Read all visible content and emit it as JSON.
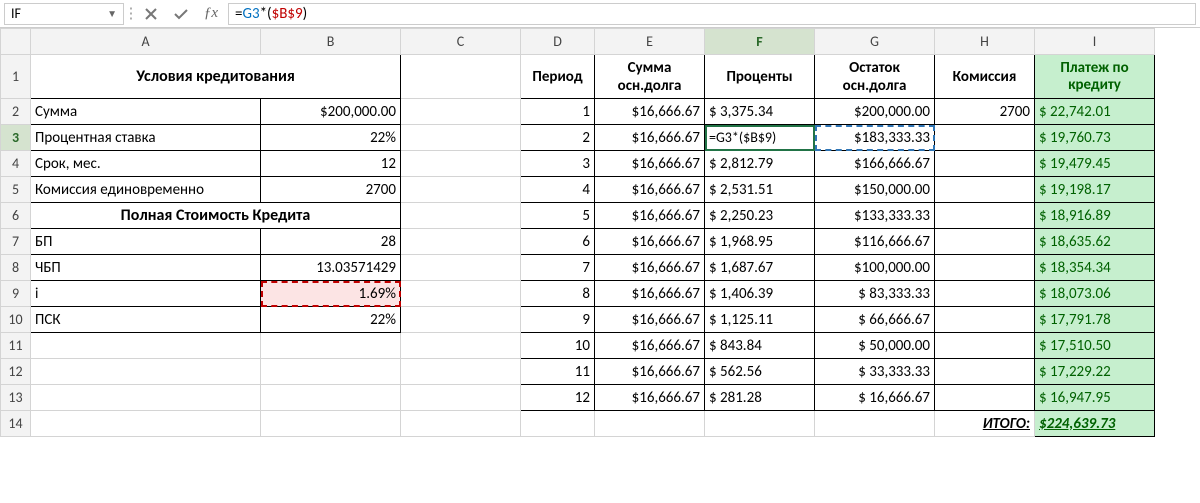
{
  "nameBox": "IF",
  "formula": {
    "prefix": "=",
    "ref1": "G3",
    "mid": "*(",
    "ref2": "$B$9",
    "suffix": ")"
  },
  "columns": [
    "A",
    "B",
    "C",
    "D",
    "E",
    "F",
    "G",
    "H",
    "I"
  ],
  "activeCol": "F",
  "activeRow": "3",
  "left": {
    "title": "Условия кредитования",
    "rows": [
      {
        "label": "Сумма",
        "value": "$200,000.00"
      },
      {
        "label": "Процентная ставка",
        "value": "22%"
      },
      {
        "label": "Срок, мес.",
        "value": "12"
      },
      {
        "label": "Комиссия единовременно",
        "value": "2700"
      }
    ],
    "title2": "Полная Стоимость Кредита",
    "rows2": [
      {
        "label": "БП",
        "value": "28"
      },
      {
        "label": "ЧБП",
        "value": "13.03571429"
      },
      {
        "label": "i",
        "value": "1.69%"
      },
      {
        "label": "ПСК",
        "value": "22%"
      }
    ]
  },
  "right": {
    "headers": {
      "D": "Период",
      "E_l1": "Сумма",
      "E_l2": "осн.долга",
      "F": "Проценты",
      "G_l1": "Остаток",
      "G_l2": "осн.долга",
      "H": "Комиссия",
      "I_l1": "Платеж по",
      "I_l2": "кредиту"
    },
    "rows": [
      {
        "p": "1",
        "sum": "$16,666.67",
        "pct": "$  3,375.34",
        "bal": "$200,000.00",
        "kom": "2700",
        "pay": "$  22,742.01"
      },
      {
        "p": "2",
        "sum": "$16,666.67",
        "pct": "=G3*($B$9)",
        "bal": "$183,333.33",
        "kom": "",
        "pay": "$  19,760.73"
      },
      {
        "p": "3",
        "sum": "$16,666.67",
        "pct": "$  2,812.79",
        "bal": "$166,666.67",
        "kom": "",
        "pay": "$  19,479.45"
      },
      {
        "p": "4",
        "sum": "$16,666.67",
        "pct": "$  2,531.51",
        "bal": "$150,000.00",
        "kom": "",
        "pay": "$  19,198.17"
      },
      {
        "p": "5",
        "sum": "$16,666.67",
        "pct": "$  2,250.23",
        "bal": "$133,333.33",
        "kom": "",
        "pay": "$  18,916.89"
      },
      {
        "p": "6",
        "sum": "$16,666.67",
        "pct": "$  1,968.95",
        "bal": "$116,666.67",
        "kom": "",
        "pay": "$  18,635.62"
      },
      {
        "p": "7",
        "sum": "$16,666.67",
        "pct": "$  1,687.67",
        "bal": "$100,000.00",
        "kom": "",
        "pay": "$  18,354.34"
      },
      {
        "p": "8",
        "sum": "$16,666.67",
        "pct": "$  1,406.39",
        "bal": "$  83,333.33",
        "kom": "",
        "pay": "$  18,073.06"
      },
      {
        "p": "9",
        "sum": "$16,666.67",
        "pct": "$  1,125.11",
        "bal": "$  66,666.67",
        "kom": "",
        "pay": "$  17,791.78"
      },
      {
        "p": "10",
        "sum": "$16,666.67",
        "pct": "$     843.84",
        "bal": "$  50,000.00",
        "kom": "",
        "pay": "$  17,510.50"
      },
      {
        "p": "11",
        "sum": "$16,666.67",
        "pct": "$     562.56",
        "bal": "$  33,333.33",
        "kom": "",
        "pay": "$  17,229.22"
      },
      {
        "p": "12",
        "sum": "$16,666.67",
        "pct": "$     281.28",
        "bal": "$  16,666.67",
        "kom": "",
        "pay": "$  16,947.95"
      }
    ],
    "totalLabel": "ИТОГО:",
    "totalValue": "$224,639.73"
  },
  "chart_data": {
    "type": "table",
    "title": "Loan payment schedule",
    "columns": [
      "Период",
      "Сумма осн.долга",
      "Проценты",
      "Остаток осн.долга",
      "Комиссия",
      "Платеж по кредиту"
    ],
    "rows": [
      [
        1,
        16666.67,
        3375.34,
        200000.0,
        2700,
        22742.01
      ],
      [
        2,
        16666.67,
        null,
        183333.33,
        null,
        19760.73
      ],
      [
        3,
        16666.67,
        2812.79,
        166666.67,
        null,
        19479.45
      ],
      [
        4,
        16666.67,
        2531.51,
        150000.0,
        null,
        19198.17
      ],
      [
        5,
        16666.67,
        2250.23,
        133333.33,
        null,
        18916.89
      ],
      [
        6,
        16666.67,
        1968.95,
        116666.67,
        null,
        18635.62
      ],
      [
        7,
        16666.67,
        1687.67,
        100000.0,
        null,
        18354.34
      ],
      [
        8,
        16666.67,
        1406.39,
        83333.33,
        null,
        18073.06
      ],
      [
        9,
        16666.67,
        1125.11,
        66666.67,
        null,
        17791.78
      ],
      [
        10,
        16666.67,
        843.84,
        50000.0,
        null,
        17510.5
      ],
      [
        11,
        16666.67,
        562.56,
        33333.33,
        null,
        17229.22
      ],
      [
        12,
        16666.67,
        281.28,
        16666.67,
        null,
        16947.95
      ]
    ],
    "total": 224639.73
  }
}
